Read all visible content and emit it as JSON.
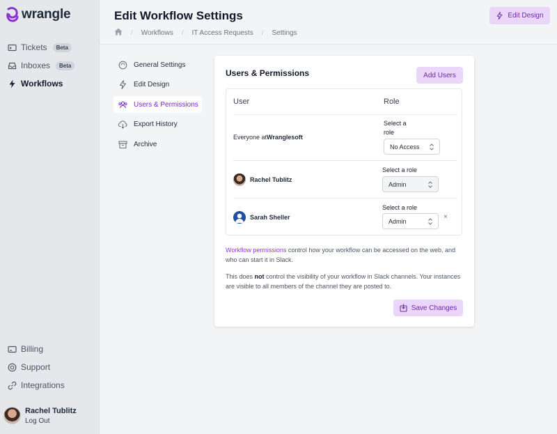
{
  "app": {
    "name": "wrangle",
    "accent": "#7e22ce",
    "accent_soft": "#ead6f8"
  },
  "sidebar": {
    "items": [
      {
        "label": "Tickets",
        "badge": "Beta",
        "icon": "ticket-icon"
      },
      {
        "label": "Inboxes",
        "badge": "Beta",
        "icon": "inbox-icon"
      },
      {
        "label": "Workflows",
        "icon": "bolt-icon"
      }
    ],
    "bottom_items": [
      {
        "label": "Billing",
        "icon": "billing-icon"
      },
      {
        "label": "Support",
        "icon": "support-icon"
      },
      {
        "label": "Integrations",
        "icon": "link-icon"
      }
    ],
    "user": {
      "name": "Rachel Tublitz",
      "logout_label": "Log Out"
    }
  },
  "header": {
    "title": "Edit Workflow Settings",
    "breadcrumb": [
      "Workflows",
      "IT Access Requests",
      "Settings"
    ],
    "edit_design_label": "Edit Design"
  },
  "settings_nav": [
    {
      "label": "General Settings",
      "icon": "gear-icon"
    },
    {
      "label": "Edit Design",
      "icon": "bolt-icon"
    },
    {
      "label": "Users & Permissions",
      "icon": "users-icon",
      "active": true
    },
    {
      "label": "Export History",
      "icon": "download-icon"
    },
    {
      "label": "Archive",
      "icon": "archive-icon"
    }
  ],
  "card": {
    "title": "Users & Permissions",
    "add_users_label": "Add Users",
    "columns": [
      "User",
      "Role"
    ],
    "rows": [
      {
        "user_prefix": "Everyone at ",
        "user_bold": "Wranglesoft",
        "role_label": "Select a role",
        "role_value": "No Access"
      },
      {
        "user": "Rachel Tublitz",
        "role_label": "Select a role",
        "role_value": "Admin"
      },
      {
        "user": "Sarah Sheller",
        "role_label": "Select a role",
        "role_value": "Admin",
        "removable_label": "×"
      }
    ],
    "desc1_link": "Workflow permissions",
    "desc1_text": " control how your workflow can be accessed on the web, and who can start it in Slack.",
    "desc2_pre": "This does ",
    "desc2_bold": "not",
    "desc2_post": " control the visibility of your workflow in Slack channels. Your instances are visible to all members of the channel they are posted to.",
    "save_label": "Save Changes"
  }
}
